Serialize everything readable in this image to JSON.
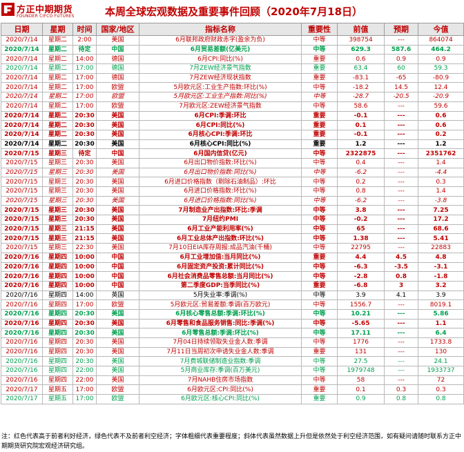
{
  "logo": {
    "name_cn": "方正中期期货",
    "name_en": "FOUNDER CIFCO FUTURES",
    "brand_color": "#c00000"
  },
  "title": "本周全球宏观数据及重要事件回顾（2020年7月18日）",
  "columns": [
    "日期",
    "星期",
    "时间",
    "国家/地区",
    "指标名称",
    "重要性",
    "前值",
    "预期",
    "今值"
  ],
  "colors": {
    "red": "#c00000",
    "green": "#00a04e",
    "black": "#000000",
    "header_bg": "#e6e6e6"
  },
  "rows": [
    {
      "date": "2020/7/14",
      "weekday": "星期二",
      "time": "2:00",
      "region": "美国",
      "name": "6月联邦政府财政赤字(盈余为负)",
      "importance": "中等",
      "prev": "398754",
      "forecast": "---",
      "actual": "864074",
      "color": "r",
      "bold": false,
      "italic": false
    },
    {
      "date": "2020/7/14",
      "weekday": "星期二",
      "time": "待定",
      "region": "中国",
      "name": "6月贸易差额(亿美元)",
      "importance": "中等",
      "prev": "629.3",
      "forecast": "587.6",
      "actual": "464.2",
      "color": "g",
      "bold": true,
      "italic": false
    },
    {
      "date": "2020/7/14",
      "weekday": "星期二",
      "time": "14:00",
      "region": "德国",
      "name": "6月CPI:同比(%)",
      "importance": "重要",
      "prev": "0.6",
      "forecast": "0.9",
      "actual": "0.9",
      "color": "r",
      "bold": false,
      "italic": false
    },
    {
      "date": "2020/7/14",
      "weekday": "星期二",
      "time": "17:00",
      "region": "德国",
      "name": "7月ZEW经济景气指数",
      "importance": "重要",
      "prev": "63.4",
      "forecast": "60",
      "actual": "59.3",
      "color": "g",
      "bold": false,
      "italic": false
    },
    {
      "date": "2020/7/14",
      "weekday": "星期二",
      "time": "17:00",
      "region": "德国",
      "name": "7月ZEW经济现状指数",
      "importance": "重要",
      "prev": "-83.1",
      "forecast": "-65",
      "actual": "-80.9",
      "color": "r",
      "bold": false,
      "italic": false
    },
    {
      "date": "2020/7/14",
      "weekday": "星期二",
      "time": "17:00",
      "region": "欧盟",
      "name": "5月欧元区:工业生产指数:环比(%)",
      "importance": "中等",
      "prev": "-18.2",
      "forecast": "14.5",
      "actual": "12.4",
      "color": "r",
      "bold": false,
      "italic": false
    },
    {
      "date": "2020/7/14",
      "weekday": "星期二",
      "time": "17:00",
      "region": "欧盟",
      "name": "5月欧元区:工业生产指数:同比(%)",
      "importance": "中等",
      "prev": "-28.7",
      "forecast": "-20.5",
      "actual": "-20.9",
      "color": "r",
      "bold": false,
      "italic": true
    },
    {
      "date": "2020/7/14",
      "weekday": "星期二",
      "time": "17:00",
      "region": "欧盟",
      "name": "7月欧元区:ZEW经济景气指数",
      "importance": "中等",
      "prev": "58.6",
      "forecast": "---",
      "actual": "59.6",
      "color": "r",
      "bold": false,
      "italic": false
    },
    {
      "date": "2020/7/14",
      "weekday": "星期二",
      "time": "20:30",
      "region": "美国",
      "name": "6月CPI:季调:环比",
      "importance": "重要",
      "prev": "-0.1",
      "forecast": "---",
      "actual": "0.6",
      "color": "r",
      "bold": true,
      "italic": false
    },
    {
      "date": "2020/7/14",
      "weekday": "星期二",
      "time": "20:30",
      "region": "美国",
      "name": "6月CPI:同比(%)",
      "importance": "重要",
      "prev": "0.1",
      "forecast": "---",
      "actual": "0.6",
      "color": "r",
      "bold": true,
      "italic": false
    },
    {
      "date": "2020/7/14",
      "weekday": "星期二",
      "time": "20:30",
      "region": "美国",
      "name": "6月核心CPI:季调:环比",
      "importance": "重要",
      "prev": "-0.1",
      "forecast": "---",
      "actual": "0.2",
      "color": "r",
      "bold": true,
      "italic": false
    },
    {
      "date": "2020/7/14",
      "weekday": "星期二",
      "time": "20:30",
      "region": "美国",
      "name": "6月核心CPI:同比(%)",
      "importance": "重要",
      "prev": "1.2",
      "forecast": "---",
      "actual": "1.2",
      "color": "k",
      "bold": true,
      "italic": false
    },
    {
      "date": "2020/7/15",
      "weekday": "星期三",
      "time": "待定",
      "region": "中国",
      "name": "6月国内信贷(亿元)",
      "importance": "中等",
      "prev": "2322875",
      "forecast": "---",
      "actual": "2351762",
      "color": "r",
      "bold": true,
      "italic": false
    },
    {
      "date": "2020/7/15",
      "weekday": "星期三",
      "time": "20:30",
      "region": "美国",
      "name": "6月出口物价指数:环比(%)",
      "importance": "中等",
      "prev": "0.4",
      "forecast": "---",
      "actual": "1.4",
      "color": "r",
      "bold": false,
      "italic": false
    },
    {
      "date": "2020/7/15",
      "weekday": "星期三",
      "time": "20:30",
      "region": "美国",
      "name": "6月出口物价指数:同比(%)",
      "importance": "中等",
      "prev": "-6.2",
      "forecast": "---",
      "actual": "-4.4",
      "color": "r",
      "bold": false,
      "italic": true
    },
    {
      "date": "2020/7/15",
      "weekday": "星期三",
      "time": "20:30",
      "region": "美国",
      "name": "6月进口价格指数（剔除石油制品）:环比",
      "importance": "中等",
      "prev": "0.2",
      "forecast": "---",
      "actual": "0.3",
      "color": "r",
      "bold": false,
      "italic": false
    },
    {
      "date": "2020/7/15",
      "weekday": "星期三",
      "time": "20:30",
      "region": "美国",
      "name": "6月进口价格指数:环比(%)",
      "importance": "中等",
      "prev": "0.8",
      "forecast": "---",
      "actual": "1.4",
      "color": "r",
      "bold": false,
      "italic": false
    },
    {
      "date": "2020/7/15",
      "weekday": "星期三",
      "time": "20:30",
      "region": "美国",
      "name": "6月进口价格指数:同比(%)",
      "importance": "中等",
      "prev": "-6.2",
      "forecast": "---",
      "actual": "-3.8",
      "color": "r",
      "bold": false,
      "italic": true
    },
    {
      "date": "2020/7/15",
      "weekday": "星期三",
      "time": "20:30",
      "region": "美国",
      "name": "7月制造业产出指数:环比:季调",
      "importance": "中等",
      "prev": "3.8",
      "forecast": "---",
      "actual": "7.25",
      "color": "r",
      "bold": true,
      "italic": false
    },
    {
      "date": "2020/7/15",
      "weekday": "星期三",
      "time": "20:30",
      "region": "美国",
      "name": "7月纽约PMI",
      "importance": "中等",
      "prev": "-0.2",
      "forecast": "---",
      "actual": "17.2",
      "color": "r",
      "bold": true,
      "italic": false
    },
    {
      "date": "2020/7/15",
      "weekday": "星期三",
      "time": "21:15",
      "region": "美国",
      "name": "6月工业产能利用率(%)",
      "importance": "中等",
      "prev": "65",
      "forecast": "---",
      "actual": "68.6",
      "color": "r",
      "bold": true,
      "italic": false
    },
    {
      "date": "2020/7/15",
      "weekday": "星期三",
      "time": "21:15",
      "region": "美国",
      "name": "6月工业总体产出指数:环比(%)",
      "importance": "中等",
      "prev": "1.38",
      "forecast": "---",
      "actual": "5.41",
      "color": "r",
      "bold": true,
      "italic": false
    },
    {
      "date": "2020/7/15",
      "weekday": "星期三",
      "time": "22:30",
      "region": "美国",
      "name": "7月10日EIA库存周报:成品汽油(千桶)",
      "importance": "中等",
      "prev": "22795",
      "forecast": "---",
      "actual": "22883",
      "color": "r",
      "bold": false,
      "italic": false
    },
    {
      "date": "2020/7/16",
      "weekday": "星期四",
      "time": "10:00",
      "region": "中国",
      "name": "6月工业增加值:当月同比(%)",
      "importance": "重要",
      "prev": "4.4",
      "forecast": "4.5",
      "actual": "4.8",
      "color": "r",
      "bold": true,
      "italic": false
    },
    {
      "date": "2020/7/16",
      "weekday": "星期四",
      "time": "10:00",
      "region": "中国",
      "name": "6月固定资产投资:累计同比(%)",
      "importance": "中等",
      "prev": "-6.3",
      "forecast": "-3.5",
      "actual": "-3.1",
      "color": "r",
      "bold": true,
      "italic": false
    },
    {
      "date": "2020/7/16",
      "weekday": "星期四",
      "time": "10:00",
      "region": "中国",
      "name": "6月社会消费品零售总额:当月同比(%)",
      "importance": "中等",
      "prev": "-2.8",
      "forecast": "0.8",
      "actual": "-1.8",
      "color": "r",
      "bold": true,
      "italic": false
    },
    {
      "date": "2020/7/16",
      "weekday": "星期四",
      "time": "10:00",
      "region": "中国",
      "name": "第二季度GDP:当季同比(%)",
      "importance": "重要",
      "prev": "-6.8",
      "forecast": "3",
      "actual": "3.2",
      "color": "r",
      "bold": true,
      "italic": false
    },
    {
      "date": "2020/7/16",
      "weekday": "星期四",
      "time": "14:00",
      "region": "英国",
      "name": "5月失业率:季调(%)",
      "importance": "中等",
      "prev": "3.9",
      "forecast": "4.1",
      "actual": "3.9",
      "color": "k",
      "bold": false,
      "italic": false
    },
    {
      "date": "2020/7/16",
      "weekday": "星期四",
      "time": "17:00",
      "region": "欧盟",
      "name": "5月欧元区:贸易差额:季调(百万欧元)",
      "importance": "中等",
      "prev": "1556.7",
      "forecast": "---",
      "actual": "8019.1",
      "color": "r",
      "bold": false,
      "italic": false
    },
    {
      "date": "2020/7/16",
      "weekday": "星期四",
      "time": "20:30",
      "region": "美国",
      "name": "6月核心零售总额:季调:环比(%)",
      "importance": "中等",
      "prev": "10.21",
      "forecast": "---",
      "actual": "5.86",
      "color": "g",
      "bold": true,
      "italic": false
    },
    {
      "date": "2020/7/16",
      "weekday": "星期四",
      "time": "20:30",
      "region": "美国",
      "name": "6月零售和食品服务销售:同比:季调(%)",
      "importance": "中等",
      "prev": "-5.65",
      "forecast": "---",
      "actual": "1.1",
      "color": "r",
      "bold": true,
      "italic": false
    },
    {
      "date": "2020/7/16",
      "weekday": "星期四",
      "time": "20:30",
      "region": "美国",
      "name": "6月零售总额:季调:环比(%)",
      "importance": "中等",
      "prev": "17.11",
      "forecast": "---",
      "actual": "6.4",
      "color": "g",
      "bold": true,
      "italic": false
    },
    {
      "date": "2020/7/16",
      "weekday": "星期四",
      "time": "20:30",
      "region": "美国",
      "name": "7月04日持续领取失业金人数:季调",
      "importance": "中等",
      "prev": "1776",
      "forecast": "---",
      "actual": "1733.8",
      "color": "r",
      "bold": false,
      "italic": false
    },
    {
      "date": "2020/7/16",
      "weekday": "星期四",
      "time": "20:30",
      "region": "美国",
      "name": "7月11日当周初次申请失业金人数:季调",
      "importance": "重要",
      "prev": "131",
      "forecast": "---",
      "actual": "130",
      "color": "r",
      "bold": false,
      "italic": false
    },
    {
      "date": "2020/7/16",
      "weekday": "星期四",
      "time": "20:30",
      "region": "美国",
      "name": "7月费城联储制造业指数:季调",
      "importance": "中等",
      "prev": "27.5",
      "forecast": "---",
      "actual": "24.1",
      "color": "g",
      "bold": false,
      "italic": false
    },
    {
      "date": "2020/7/16",
      "weekday": "星期四",
      "time": "22:00",
      "region": "美国",
      "name": "5月商业库存:季调(百万美元)",
      "importance": "中等",
      "prev": "1979748",
      "forecast": "---",
      "actual": "1933737",
      "color": "g",
      "bold": false,
      "italic": false
    },
    {
      "date": "2020/7/16",
      "weekday": "星期四",
      "time": "22:00",
      "region": "美国",
      "name": "7月NAHB住房市场指数",
      "importance": "中等",
      "prev": "58",
      "forecast": "---",
      "actual": "72",
      "color": "r",
      "bold": false,
      "italic": false
    },
    {
      "date": "2020/7/17",
      "weekday": "星期五",
      "time": "17:00",
      "region": "欧盟",
      "name": "6月欧元区:CPI:同比(%)",
      "importance": "重要",
      "prev": "0.1",
      "forecast": "0.3",
      "actual": "0.3",
      "color": "r",
      "bold": false,
      "italic": false
    },
    {
      "date": "2020/7/17",
      "weekday": "星期五",
      "time": "17:00",
      "region": "欧盟",
      "name": "6月欧元区:核心CPI:同比(%)",
      "importance": "重要",
      "prev": "0.9",
      "forecast": "0.8",
      "actual": "0.8",
      "color": "g",
      "bold": false,
      "italic": false
    }
  ],
  "note": "注：红色代表高于前者利好经济，绿色代表不及前者利空经济；字体粗细代表重要程度；斜体代表虽然数据上升但是依然处于利空经济范围，如有疑问请随时联系方正中期期货研究院宏观经济研究组。"
}
